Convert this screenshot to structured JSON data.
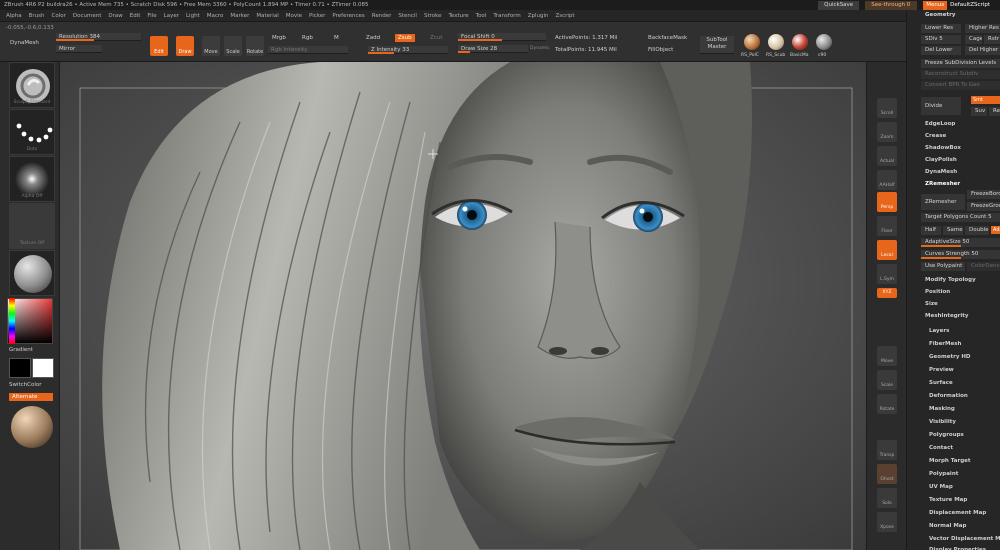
{
  "titlebar": {
    "left_text": "ZBrush 4R6 P2   buildra26   • Active Mem 735 • Scratch Disk 596 • Free Mem 3360 • PolyCount 1.894 MP • Timer 0.71 • ZTimer 0.085",
    "quicksave": "QuickSave",
    "seethrough": "See-through 0",
    "menus": "Menus",
    "script": "DefaultZScript"
  },
  "menubar": [
    "Alpha",
    "Brush",
    "Color",
    "Document",
    "Draw",
    "Edit",
    "File",
    "Layer",
    "Light",
    "Macro",
    "Marker",
    "Material",
    "Movie",
    "Picker",
    "Preferences",
    "Render",
    "Stencil",
    "Stroke",
    "Texture",
    "Tool",
    "Transform",
    "Zplugin",
    "Zscript"
  ],
  "shelf": {
    "coords": "-0.055,-0.6,0.133",
    "dynamesh": "DynaMesh",
    "resolution": "Resolution 384",
    "mirror": "Mirror",
    "edit": "Edit",
    "draw": "Draw",
    "move": "Move",
    "scale": "Scale",
    "rotate": "Rotate",
    "mrgb": "Mrgb",
    "rgb": "Rgb",
    "m": "M",
    "rgb_intensity": "Rgb Intensity",
    "zadd": "Zadd",
    "zsub": "Zsub",
    "zcut": "Zcut",
    "z_intensity": "Z Intensity 33",
    "focal_shift": "Focal Shift 0",
    "draw_size": "Draw Size 28",
    "dynamic": "Dynamic",
    "active_points": "ActivePoints: 1.317 Mil",
    "total_points": "TotalPoints: 11.945 Mil",
    "backface": "BackfaceMask",
    "fillobject": "FillObject",
    "subtool_master": "SubTool Master",
    "materials": [
      "RS_PolC",
      "RS_Scub",
      "BasicMa",
      "c90"
    ]
  },
  "lefttray": {
    "brush_label": "Sculpt_Standard",
    "stroke_label": "Dots",
    "alpha_label": "Alpha Off",
    "texture_label": "Texture Off",
    "material_label": "c90",
    "gradient": "Gradient",
    "switchcolor": "SwitchColor",
    "alternate": "Alternate"
  },
  "rshelf": [
    "Scroll",
    "Zoom",
    "Actual",
    "AAHalf",
    "Persp",
    "Floor",
    "Local",
    "L.Sym",
    "XYZ",
    "Move",
    "Scale",
    "Rotate",
    "Transp",
    "Ghost",
    "Solo",
    "Xpose"
  ],
  "rpal": {
    "geometry": "Geometry",
    "lower_res": "Lower Res",
    "higher_res": "Higher Res",
    "sdiv": "SDiv 5",
    "cage": "Cage",
    "rstr": "Rstr",
    "del_lower": "Del Lower",
    "del_higher": "Del Higher",
    "freeze_subdiv": "Freeze SubDivision Levels",
    "reconstruct": "Reconstruct Subdiv",
    "convert_bpr": "Convert BPR To Geo",
    "divide": "Divide",
    "smt": "Smt",
    "suv": "Suv",
    "reuv": "ReUV",
    "edgeloop": "EdgeLoop",
    "crease": "Crease",
    "shadowbox": "ShadowBox",
    "claypolish": "ClayPolish",
    "dynamesh": "DynaMesh",
    "zremesher_header": "ZRemesher",
    "zremesher": "ZRemesher",
    "freeze_border": "FreezeBorder",
    "freeze_groups": "FreezeGroups",
    "target_polys": "Target Polygons Count 5",
    "half": "Half",
    "same": "Same",
    "double": "Double",
    "adapt": "Adapt",
    "adaptive_size": "AdaptiveSize 50",
    "curves_strength": "Curves Strength 50",
    "use_polypaint": "Use Polypaint",
    "colordensity": "ColorDensity",
    "modify_topology": "Modify Topology",
    "position": "Position",
    "size": "Size",
    "meshintegrity": "MeshIntegrity",
    "subpalettes": [
      "Layers",
      "FiberMesh",
      "Geometry HD",
      "Preview",
      "Surface",
      "Deformation",
      "Masking",
      "Visibility",
      "Polygroups",
      "Contact",
      "Morph Target",
      "Polypaint",
      "UV Map",
      "Texture Map",
      "Displacement Map",
      "Normal Map",
      "Vector Displacement Map",
      "Display Properties"
    ]
  },
  "colors": {
    "accent": "#e8661c",
    "bg": "#2a2a2a",
    "iris": "#3a8ec8"
  }
}
